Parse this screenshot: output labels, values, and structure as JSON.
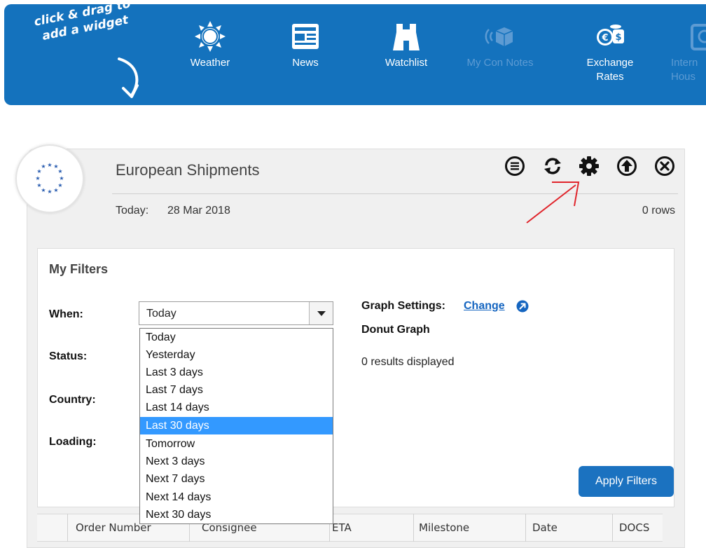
{
  "topbar": {
    "hint_line1": "click & drag to",
    "hint_line2": "add a widget",
    "widgets": [
      {
        "label_line1": "Weather",
        "label_line2": "",
        "icon": "sun-icon",
        "enabled": true
      },
      {
        "label_line1": "News",
        "label_line2": "",
        "icon": "newspaper-icon",
        "enabled": true
      },
      {
        "label_line1": "Watchlist",
        "label_line2": "",
        "icon": "binoculars-icon",
        "enabled": true
      },
      {
        "label_line1": "My Con Notes",
        "label_line2": "",
        "icon": "box-broadcast-icon",
        "enabled": false
      },
      {
        "label_line1": "Exchange",
        "label_line2": "Rates",
        "icon": "currency-coins-icon",
        "enabled": true
      },
      {
        "label_line1": "Intern",
        "label_line2": "Hous",
        "icon": "house-icon",
        "enabled": false
      }
    ]
  },
  "panel": {
    "title": "European Shipments",
    "today_label": "Today:",
    "today_value": "28 Mar 2018",
    "rows_count": "0 rows",
    "toolbar_icons": [
      "list-icon",
      "refresh-icon",
      "gear-icon",
      "arrow-up-icon",
      "close-icon"
    ]
  },
  "filters": {
    "title": "My Filters",
    "when_label": "When:",
    "status_label": "Status:",
    "country_label": "Country:",
    "loading_label": "Loading:",
    "when_selected": "Today",
    "when_options": [
      "Today",
      "Yesterday",
      "Last 3 days",
      "Last 7 days",
      "Last 14 days",
      "Last 30 days",
      "Tomorrow",
      "Next 3 days",
      "Next 7 days",
      "Next 14 days",
      "Next 30 days"
    ],
    "highlighted_option": "Last 30 days",
    "graph_settings_label": "Graph Settings:",
    "graph_change_link": "Change",
    "graph_type": "Donut Graph",
    "results_text": "0 results displayed",
    "apply_button": "Apply Filters"
  },
  "table": {
    "columns": [
      "Order Number",
      "Consignee",
      "ETA",
      "Milestone",
      "Date",
      "DOCS"
    ]
  },
  "colors": {
    "topbar_bg": "#1472bd",
    "accent_blue": "#1b72c0",
    "highlight": "#3399ff",
    "annotation_arrow": "#e0242b"
  }
}
